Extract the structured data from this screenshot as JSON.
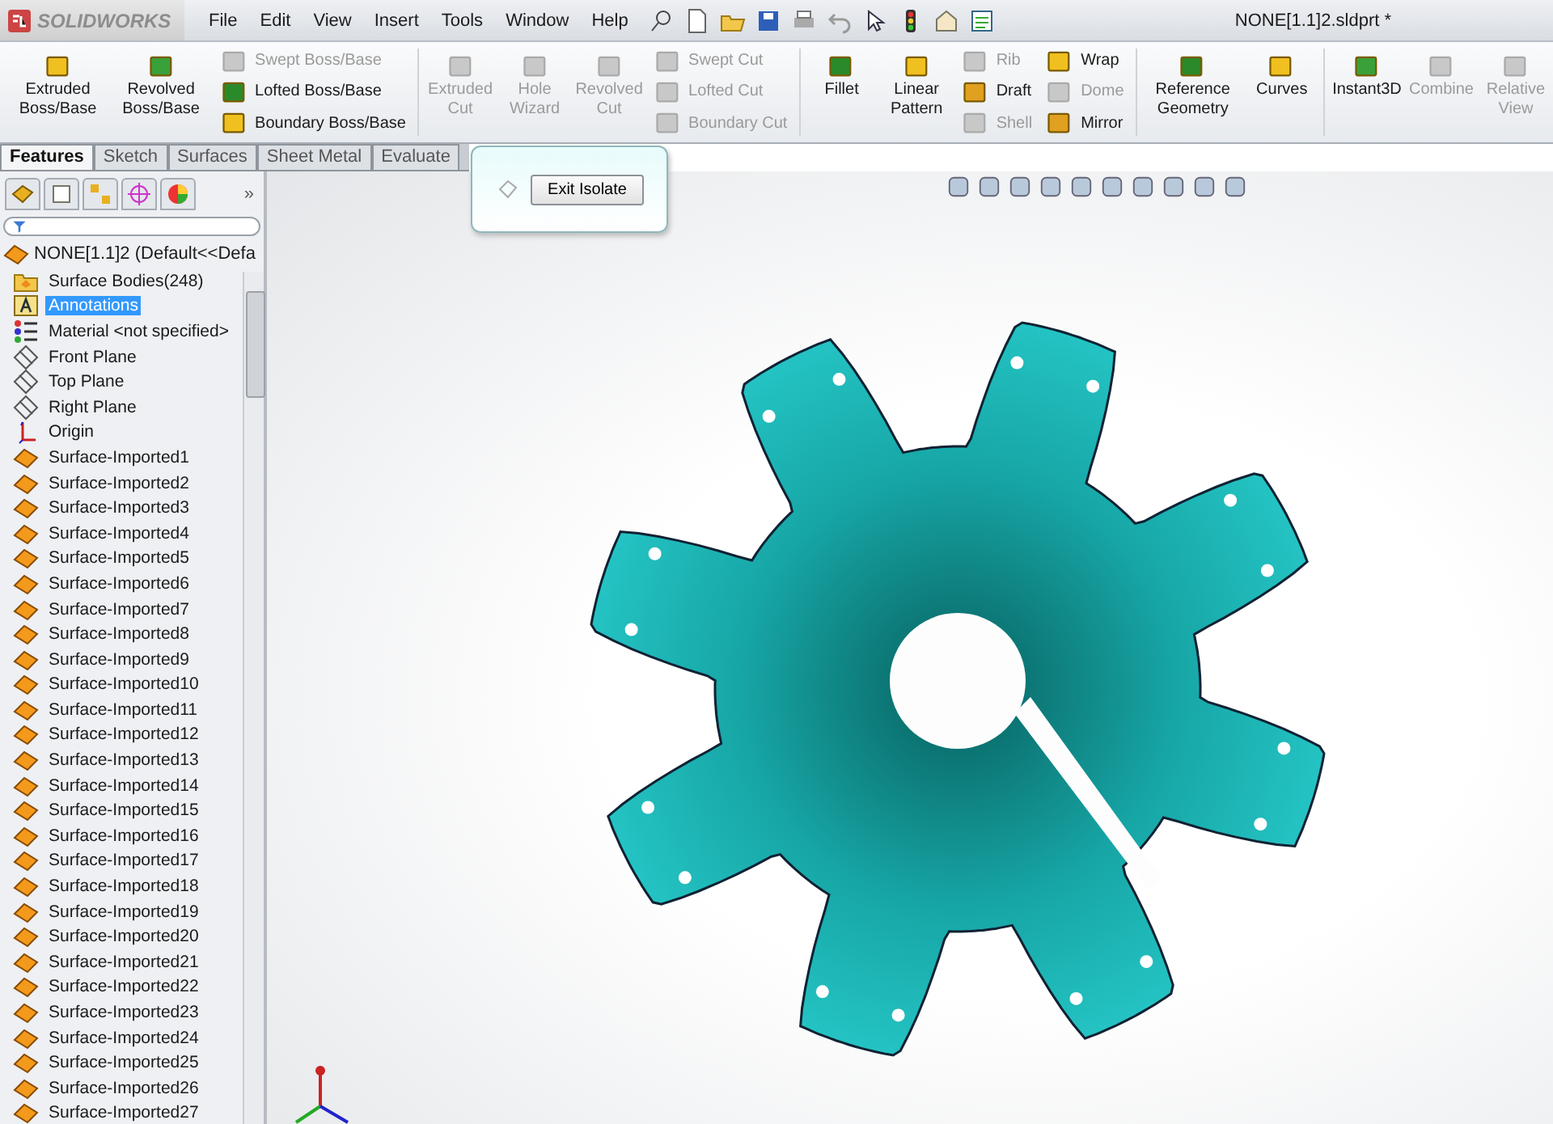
{
  "app": {
    "logo_text": "SOLIDWORKS",
    "title": "NONE[1.1]2.sldprt *"
  },
  "menu": [
    "File",
    "Edit",
    "View",
    "Insert",
    "Tools",
    "Window",
    "Help"
  ],
  "ribbon": [
    {
      "kind": "large",
      "label": "Extruded Boss/Base",
      "disabled": false
    },
    {
      "kind": "large",
      "label": "Revolved Boss/Base",
      "disabled": false
    },
    {
      "kind": "stack",
      "items": [
        {
          "label": "Swept Boss/Base",
          "disabled": true
        },
        {
          "label": "Lofted Boss/Base",
          "disabled": false
        },
        {
          "label": "Boundary Boss/Base",
          "disabled": false
        }
      ]
    },
    {
      "kind": "sep"
    },
    {
      "kind": "large",
      "label": "Extruded Cut",
      "disabled": true
    },
    {
      "kind": "large",
      "label": "Hole Wizard",
      "disabled": true
    },
    {
      "kind": "large",
      "label": "Revolved Cut",
      "disabled": true
    },
    {
      "kind": "stack",
      "items": [
        {
          "label": "Swept Cut",
          "disabled": true
        },
        {
          "label": "Lofted Cut",
          "disabled": true
        },
        {
          "label": "Boundary Cut",
          "disabled": true
        }
      ]
    },
    {
      "kind": "sep"
    },
    {
      "kind": "large",
      "label": "Fillet",
      "disabled": false
    },
    {
      "kind": "large",
      "label": "Linear Pattern",
      "disabled": false
    },
    {
      "kind": "stack",
      "items": [
        {
          "label": "Rib",
          "disabled": true
        },
        {
          "label": "Draft",
          "disabled": false
        },
        {
          "label": "Shell",
          "disabled": true
        }
      ]
    },
    {
      "kind": "stack",
      "items": [
        {
          "label": "Wrap",
          "disabled": false
        },
        {
          "label": "Dome",
          "disabled": true
        },
        {
          "label": "Mirror",
          "disabled": false
        }
      ]
    },
    {
      "kind": "sep"
    },
    {
      "kind": "large",
      "label": "Reference Geometry",
      "disabled": false
    },
    {
      "kind": "large",
      "label": "Curves",
      "disabled": false
    },
    {
      "kind": "sep"
    },
    {
      "kind": "large",
      "label": "Instant3D",
      "disabled": false
    },
    {
      "kind": "large",
      "label": "Combine",
      "disabled": true
    },
    {
      "kind": "large",
      "label": "Relative View",
      "disabled": true
    }
  ],
  "tabs": [
    {
      "label": "Features",
      "selected": true
    },
    {
      "label": "Sketch",
      "selected": false
    },
    {
      "label": "Surfaces",
      "selected": false
    },
    {
      "label": "Sheet Metal",
      "selected": false
    },
    {
      "label": "Evaluate",
      "selected": false
    }
  ],
  "pane_more": "»",
  "isolate_popup": {
    "button": "Exit Isolate"
  },
  "tree": {
    "root": "NONE[1.1]2  (Default<<Defa",
    "items": [
      {
        "kind": "folder",
        "label": "Surface Bodies(248)",
        "selected": false
      },
      {
        "kind": "annotation",
        "label": "Annotations",
        "selected": true
      },
      {
        "kind": "material",
        "label": "Material <not specified>",
        "selected": false
      },
      {
        "kind": "plane",
        "label": "Front Plane",
        "selected": false
      },
      {
        "kind": "plane",
        "label": "Top Plane",
        "selected": false
      },
      {
        "kind": "plane",
        "label": "Right Plane",
        "selected": false
      },
      {
        "kind": "origin",
        "label": "Origin",
        "selected": false
      },
      {
        "kind": "surface",
        "label": "Surface-Imported1",
        "selected": false
      },
      {
        "kind": "surface",
        "label": "Surface-Imported2",
        "selected": false
      },
      {
        "kind": "surface",
        "label": "Surface-Imported3",
        "selected": false
      },
      {
        "kind": "surface",
        "label": "Surface-Imported4",
        "selected": false
      },
      {
        "kind": "surface",
        "label": "Surface-Imported5",
        "selected": false
      },
      {
        "kind": "surface",
        "label": "Surface-Imported6",
        "selected": false
      },
      {
        "kind": "surface",
        "label": "Surface-Imported7",
        "selected": false
      },
      {
        "kind": "surface",
        "label": "Surface-Imported8",
        "selected": false
      },
      {
        "kind": "surface",
        "label": "Surface-Imported9",
        "selected": false
      },
      {
        "kind": "surface",
        "label": "Surface-Imported10",
        "selected": false
      },
      {
        "kind": "surface",
        "label": "Surface-Imported11",
        "selected": false
      },
      {
        "kind": "surface",
        "label": "Surface-Imported12",
        "selected": false
      },
      {
        "kind": "surface",
        "label": "Surface-Imported13",
        "selected": false
      },
      {
        "kind": "surface",
        "label": "Surface-Imported14",
        "selected": false
      },
      {
        "kind": "surface",
        "label": "Surface-Imported15",
        "selected": false
      },
      {
        "kind": "surface",
        "label": "Surface-Imported16",
        "selected": false
      },
      {
        "kind": "surface",
        "label": "Surface-Imported17",
        "selected": false
      },
      {
        "kind": "surface",
        "label": "Surface-Imported18",
        "selected": false
      },
      {
        "kind": "surface",
        "label": "Surface-Imported19",
        "selected": false
      },
      {
        "kind": "surface",
        "label": "Surface-Imported20",
        "selected": false
      },
      {
        "kind": "surface",
        "label": "Surface-Imported21",
        "selected": false
      },
      {
        "kind": "surface",
        "label": "Surface-Imported22",
        "selected": false
      },
      {
        "kind": "surface",
        "label": "Surface-Imported23",
        "selected": false
      },
      {
        "kind": "surface",
        "label": "Surface-Imported24",
        "selected": false
      },
      {
        "kind": "surface",
        "label": "Surface-Imported25",
        "selected": false
      },
      {
        "kind": "surface",
        "label": "Surface-Imported26",
        "selected": false
      },
      {
        "kind": "surface",
        "label": "Surface-Imported27",
        "selected": false
      }
    ]
  }
}
